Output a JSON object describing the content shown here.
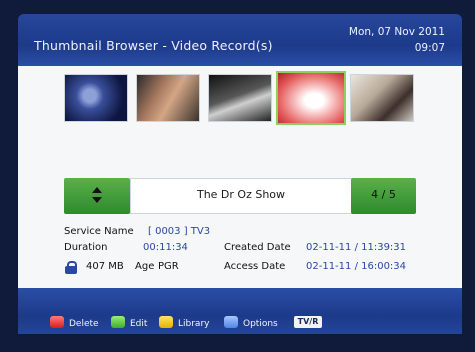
{
  "header": {
    "title": "Thumbnail Browser - Video Record(s)",
    "date_line_1": "Mon, 07 Nov 2011",
    "date_line_2": "09:07"
  },
  "thumbnails": [
    {
      "name": "thumbnail-1",
      "selected": false
    },
    {
      "name": "thumbnail-2",
      "selected": false
    },
    {
      "name": "thumbnail-3",
      "selected": false
    },
    {
      "name": "thumbnail-4",
      "selected": true
    },
    {
      "name": "thumbnail-5",
      "selected": false
    }
  ],
  "selector": {
    "program_title": "The Dr Oz Show",
    "counter": "4 / 5",
    "nav_icon": "up-down-arrows-icon"
  },
  "info": {
    "service_label": "Service Name",
    "service_value": "[ 0003 ]  TV3",
    "duration_label": "Duration",
    "duration_value": "00:11:34",
    "created_label": "Created Date",
    "created_value": "02-11-11 / 11:39:31",
    "size_value": "407 MB",
    "age_label": "Age",
    "age_value": "PGR",
    "access_label": "Access Date",
    "access_value": "02-11-11 / 16:00:34",
    "lock_icon": "lock-icon"
  },
  "footer": {
    "delete_label": "Delete",
    "edit_label": "Edit",
    "library_label": "Library",
    "options_label": "Options",
    "tvr_label": "TV/R"
  },
  "colors": {
    "header_blue": "#1d3a8a",
    "accent_green": "#3eae2c",
    "value_blue": "#2a47a4",
    "selected_border": "#8fd05a"
  }
}
